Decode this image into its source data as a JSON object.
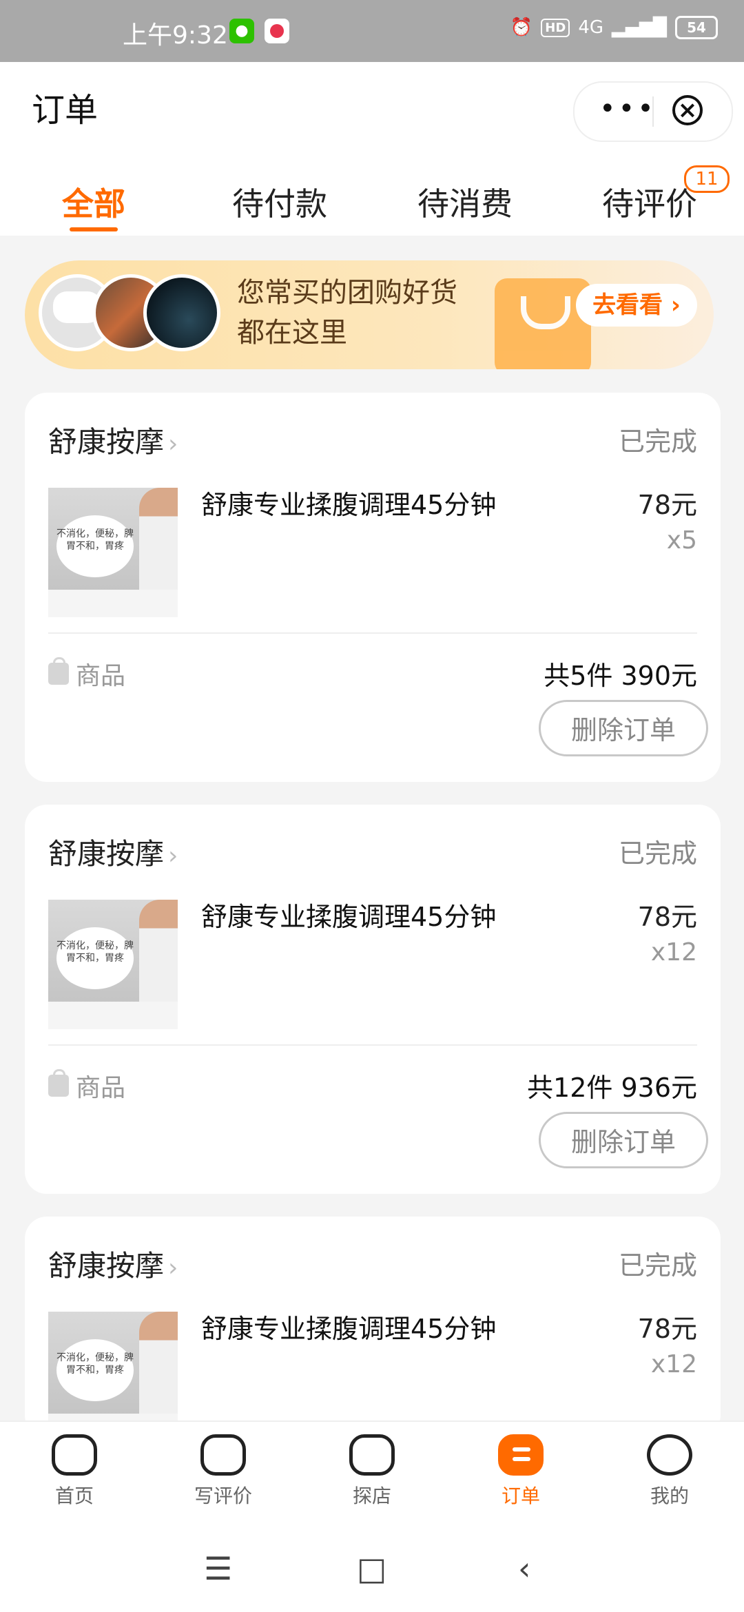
{
  "status_bar": {
    "time": "上午9:32",
    "network": "4G",
    "hd": "HD",
    "battery": "54"
  },
  "header": {
    "title": "订单",
    "more_label": "•••",
    "close_label": "×"
  },
  "tabs": [
    {
      "label": "全部",
      "active": true
    },
    {
      "label": "待付款"
    },
    {
      "label": "待消费"
    },
    {
      "label": "待评价",
      "badge": "11"
    }
  ],
  "banner": {
    "line1": "您常买的团购好货",
    "line2": "都在这里",
    "button": "去看看 ›"
  },
  "orders": [
    {
      "shop": "舒康按摩",
      "status": "已完成",
      "thumb_text": "不消化，便秘，脾胃不和，胃疼",
      "item": "舒康专业揉腹调理45分钟",
      "price": "78元",
      "qty": "x5",
      "goods_label": "商品",
      "total": "共5件  390元",
      "delete": "删除订单"
    },
    {
      "shop": "舒康按摩",
      "status": "已完成",
      "thumb_text": "不消化，便秘，脾胃不和，胃疼",
      "item": "舒康专业揉腹调理45分钟",
      "price": "78元",
      "qty": "x12",
      "goods_label": "商品",
      "total": "共12件  936元",
      "delete": "删除订单"
    },
    {
      "shop": "舒康按摩",
      "status": "已完成",
      "thumb_text": "不消化，便秘，脾胃不和，胃疼",
      "item": "舒康专业揉腹调理45分钟",
      "price": "78元",
      "qty": "x12"
    }
  ],
  "bottom_nav": [
    {
      "label": "首页",
      "icon": "home-icon"
    },
    {
      "label": "写评价",
      "icon": "review-icon"
    },
    {
      "label": "探店",
      "icon": "store-icon"
    },
    {
      "label": "订单",
      "icon": "order-icon",
      "active": true
    },
    {
      "label": "我的",
      "icon": "profile-icon"
    }
  ],
  "system_nav": {
    "menu": "☰",
    "home": "□",
    "back": "‹"
  },
  "colors": {
    "accent": "#ff6a00"
  }
}
